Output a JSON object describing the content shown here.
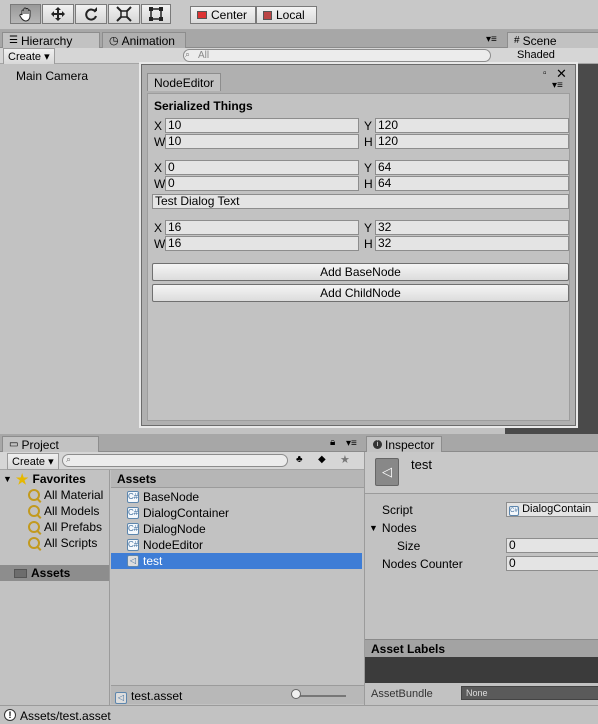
{
  "toolbar": {
    "tools": [
      "hand-tool",
      "move-tool",
      "rotate-tool",
      "scale-tool",
      "rect-tool"
    ],
    "pivot_label": "Center",
    "space_label": "Local"
  },
  "hierarchy": {
    "tab_label": "Hierarchy",
    "create_label": "Create",
    "search_placeholder": "All",
    "items": [
      "Main Camera"
    ]
  },
  "animation": {
    "tab_label": "Animation"
  },
  "scene": {
    "tab_label": "Scene",
    "shading_label": "Shaded"
  },
  "node_editor": {
    "title": "NodeEditor",
    "heading": "Serialized Things",
    "groups": [
      {
        "x": "10",
        "y": "120",
        "w": "10",
        "h": "120"
      },
      {
        "x": "0",
        "y": "64",
        "w": "0",
        "h": "64",
        "text": "Test Dialog Text"
      },
      {
        "x": "16",
        "y": "32",
        "w": "16",
        "h": "32"
      }
    ],
    "labels": {
      "x": "X",
      "y": "Y",
      "w": "W",
      "h": "H"
    },
    "add_base_label": "Add BaseNode",
    "add_child_label": "Add ChildNode"
  },
  "project": {
    "tab_label": "Project",
    "create_label": "Create",
    "favorites_label": "Favorites",
    "favorites": [
      "All Material",
      "All Models",
      "All Prefabs",
      "All Scripts"
    ],
    "assets_folder_label": "Assets",
    "assets_header": "Assets",
    "assets": [
      "BaseNode",
      "DialogContainer",
      "DialogNode",
      "NodeEditor",
      "test"
    ],
    "selected_asset": "test",
    "footer_file": "test.asset"
  },
  "inspector": {
    "tab_label": "Inspector",
    "object_name": "test",
    "script_label": "Script",
    "script_value": "DialogContain",
    "nodes_label": "Nodes",
    "size_label": "Size",
    "size_value": "0",
    "nodes_counter_label": "Nodes Counter",
    "nodes_counter_value": "0",
    "asset_labels_title": "Asset Labels",
    "asset_bundle_label": "AssetBundle",
    "asset_bundle_value": "None"
  },
  "status_bar": {
    "message": "Assets/test.asset"
  },
  "colors": {
    "selection": "#3e7dd6",
    "accent_yellow": "#e6b800"
  }
}
